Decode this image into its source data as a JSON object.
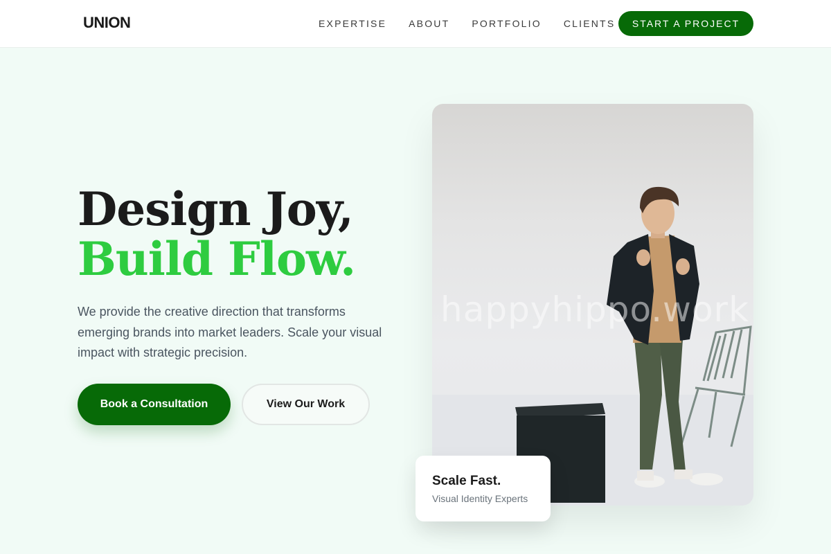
{
  "brand": {
    "logo": "UNION"
  },
  "nav": {
    "items": [
      {
        "label": "EXPERTISE"
      },
      {
        "label": "ABOUT"
      },
      {
        "label": "PORTFOLIO"
      },
      {
        "label": "CLIENTS"
      }
    ],
    "cta_label": "START A PROJECT"
  },
  "hero": {
    "headline_line1": "Design Joy,",
    "headline_line2": "Build Flow.",
    "description": "We provide the creative direction that transforms emerging brands into market leaders. Scale your visual impact with strategic precision.",
    "primary_button": "Book a Consultation",
    "secondary_button": "View Our Work",
    "image_watermark": "happyhippo.work"
  },
  "card": {
    "title": "Scale Fast.",
    "subtitle": "Visual Identity Experts"
  },
  "colors": {
    "brand_green": "#076a07",
    "accent_green": "#2ecc40",
    "background": "#f1fbf6",
    "text_dark": "#1b1b1b"
  }
}
